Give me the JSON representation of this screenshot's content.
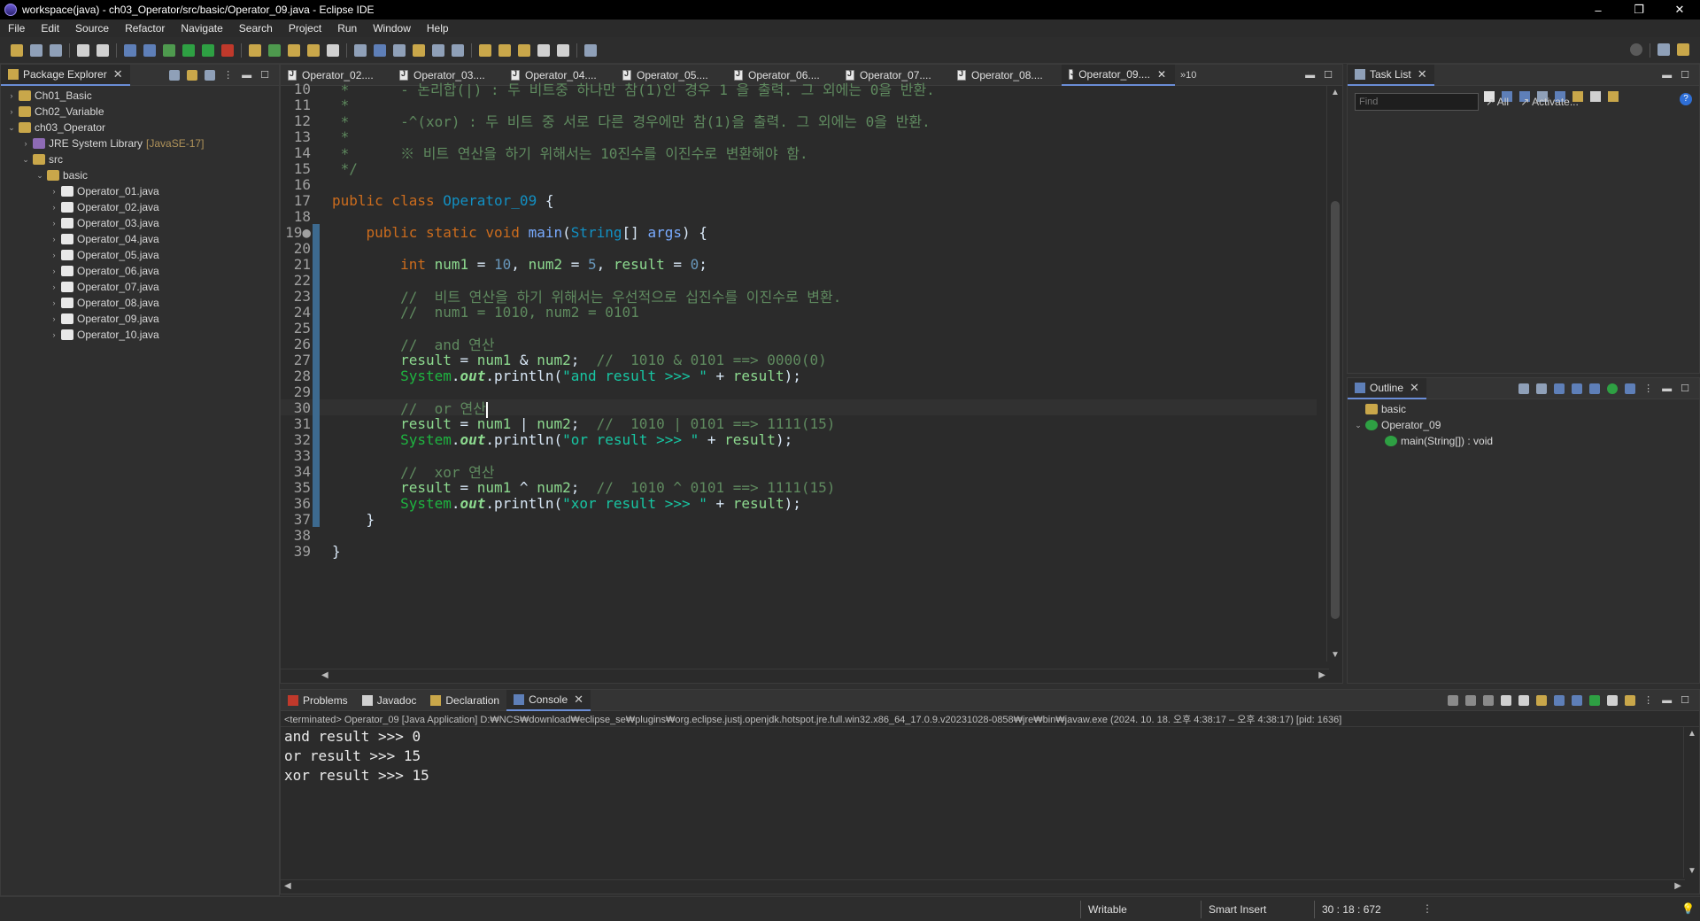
{
  "window": {
    "title": "workspace(java) - ch03_Operator/src/basic/Operator_09.java - Eclipse IDE",
    "minimize": "–",
    "restore": "❐",
    "close": "✕"
  },
  "menu": [
    "File",
    "Edit",
    "Source",
    "Refactor",
    "Navigate",
    "Search",
    "Project",
    "Run",
    "Window",
    "Help"
  ],
  "package_explorer": {
    "tab_label": "Package Explorer",
    "items": [
      {
        "label": "Ch01_Basic",
        "indent": 0,
        "twisty": "›",
        "icon": "project-icon"
      },
      {
        "label": "Ch02_Variable",
        "indent": 0,
        "twisty": "›",
        "icon": "project-icon"
      },
      {
        "label": "ch03_Operator",
        "indent": 0,
        "twisty": "⌄",
        "icon": "project-icon"
      },
      {
        "label": "JRE System Library",
        "tag": "[JavaSE-17]",
        "indent": 1,
        "twisty": "›",
        "icon": "library-icon"
      },
      {
        "label": "src",
        "indent": 1,
        "twisty": "⌄",
        "icon": "source-folder-icon"
      },
      {
        "label": "basic",
        "indent": 2,
        "twisty": "⌄",
        "icon": "package-icon"
      },
      {
        "label": "Operator_01.java",
        "indent": 3,
        "twisty": "›",
        "icon": "java-file-icon"
      },
      {
        "label": "Operator_02.java",
        "indent": 3,
        "twisty": "›",
        "icon": "java-file-icon"
      },
      {
        "label": "Operator_03.java",
        "indent": 3,
        "twisty": "›",
        "icon": "java-file-icon"
      },
      {
        "label": "Operator_04.java",
        "indent": 3,
        "twisty": "›",
        "icon": "java-file-icon"
      },
      {
        "label": "Operator_05.java",
        "indent": 3,
        "twisty": "›",
        "icon": "java-file-icon"
      },
      {
        "label": "Operator_06.java",
        "indent": 3,
        "twisty": "›",
        "icon": "java-file-icon"
      },
      {
        "label": "Operator_07.java",
        "indent": 3,
        "twisty": "›",
        "icon": "java-file-icon"
      },
      {
        "label": "Operator_08.java",
        "indent": 3,
        "twisty": "›",
        "icon": "java-file-icon"
      },
      {
        "label": "Operator_09.java",
        "indent": 3,
        "twisty": "›",
        "icon": "java-file-icon"
      },
      {
        "label": "Operator_10.java",
        "indent": 3,
        "twisty": "›",
        "icon": "java-file-icon"
      }
    ]
  },
  "editor": {
    "tabs": [
      "Operator_02....",
      "Operator_03....",
      "Operator_04....",
      "Operator_05....",
      "Operator_06....",
      "Operator_07....",
      "Operator_08....",
      "Operator_09...."
    ],
    "active_tab": 7,
    "overflow": "»10",
    "lines": [
      {
        "n": "10",
        "tokens": [
          [
            "cm",
            " *      - 논리합(|) : 두 비트중 하나만 참(1)인 경우 1 을 출력. 그 외에는 0을 반환."
          ]
        ]
      },
      {
        "n": "11",
        "tokens": [
          [
            "cm",
            " *"
          ]
        ]
      },
      {
        "n": "12",
        "tokens": [
          [
            "cm",
            " *      -^(xor) : 두 비트 중 서로 다른 경우에만 참(1)을 출력. 그 외에는 0을 반환."
          ]
        ]
      },
      {
        "n": "13",
        "tokens": [
          [
            "cm",
            " *"
          ]
        ]
      },
      {
        "n": "14",
        "tokens": [
          [
            "cm",
            " *      ※ 비트 연산을 하기 위해서는 10진수를 이진수로 변환해야 함."
          ]
        ]
      },
      {
        "n": "15",
        "tokens": [
          [
            "cm",
            " */"
          ]
        ]
      },
      {
        "n": "16",
        "tokens": []
      },
      {
        "n": "17",
        "tokens": [
          [
            "kw",
            "public class "
          ],
          [
            "cls",
            "Operator_09"
          ],
          [
            "plain",
            " {"
          ]
        ]
      },
      {
        "n": "18",
        "tokens": []
      },
      {
        "n": "19●",
        "tokens": [
          [
            "plain",
            "    "
          ],
          [
            "kw",
            "public static void "
          ],
          [
            "par",
            "main"
          ],
          [
            "plain",
            "("
          ],
          [
            "cls",
            "String"
          ],
          [
            "plain",
            "[] "
          ],
          [
            "par",
            "args"
          ],
          [
            "plain",
            ") {"
          ]
        ]
      },
      {
        "n": "20",
        "tokens": []
      },
      {
        "n": "21",
        "tokens": [
          [
            "plain",
            "        "
          ],
          [
            "kw",
            "int "
          ],
          [
            "fld",
            "num1"
          ],
          [
            "plain",
            " = "
          ],
          [
            "num",
            "10"
          ],
          [
            "plain",
            ", "
          ],
          [
            "fld",
            "num2"
          ],
          [
            "plain",
            " = "
          ],
          [
            "num",
            "5"
          ],
          [
            "plain",
            ", "
          ],
          [
            "fld",
            "result"
          ],
          [
            "plain",
            " = "
          ],
          [
            "num",
            "0"
          ],
          [
            "plain",
            ";"
          ]
        ]
      },
      {
        "n": "22",
        "tokens": []
      },
      {
        "n": "23",
        "tokens": [
          [
            "plain",
            "        "
          ],
          [
            "cm",
            "//  비트 연산을 하기 위해서는 우선적으로 십진수를 이진수로 변환."
          ]
        ]
      },
      {
        "n": "24",
        "tokens": [
          [
            "plain",
            "        "
          ],
          [
            "cm",
            "//  num1 = 1010, num2 = 0101"
          ]
        ]
      },
      {
        "n": "25",
        "tokens": []
      },
      {
        "n": "26",
        "tokens": [
          [
            "plain",
            "        "
          ],
          [
            "cm",
            "//  and 연산"
          ]
        ]
      },
      {
        "n": "27",
        "tokens": [
          [
            "plain",
            "        "
          ],
          [
            "fld",
            "result"
          ],
          [
            "plain",
            " = "
          ],
          [
            "fld",
            "num1"
          ],
          [
            "plain",
            " & "
          ],
          [
            "fld",
            "num2"
          ],
          [
            "plain",
            ";  "
          ],
          [
            "cm",
            "//  1010 & 0101 ==> 0000(0)"
          ]
        ]
      },
      {
        "n": "28",
        "tokens": [
          [
            "plain",
            "        "
          ],
          [
            "sysout",
            "System"
          ],
          [
            "plain",
            "."
          ],
          [
            "outf",
            "out"
          ],
          [
            "plain",
            ".println("
          ],
          [
            "str",
            "\"and result >>> \""
          ],
          [
            "plain",
            " + "
          ],
          [
            "fld",
            "result"
          ],
          [
            "plain",
            ");"
          ]
        ]
      },
      {
        "n": "29",
        "tokens": []
      },
      {
        "n": "30",
        "tokens": [
          [
            "plain",
            "        "
          ],
          [
            "cm",
            "//  or 연산"
          ]
        ],
        "current": true
      },
      {
        "n": "31",
        "tokens": [
          [
            "plain",
            "        "
          ],
          [
            "fld",
            "result"
          ],
          [
            "plain",
            " = "
          ],
          [
            "fld",
            "num1"
          ],
          [
            "plain",
            " | "
          ],
          [
            "fld",
            "num2"
          ],
          [
            "plain",
            ";  "
          ],
          [
            "cm",
            "//  1010 | 0101 ==> 1111(15)"
          ]
        ]
      },
      {
        "n": "32",
        "tokens": [
          [
            "plain",
            "        "
          ],
          [
            "sysout",
            "System"
          ],
          [
            "plain",
            "."
          ],
          [
            "outf",
            "out"
          ],
          [
            "plain",
            ".println("
          ],
          [
            "str",
            "\"or result >>> \""
          ],
          [
            "plain",
            " + "
          ],
          [
            "fld",
            "result"
          ],
          [
            "plain",
            ");"
          ]
        ]
      },
      {
        "n": "33",
        "tokens": []
      },
      {
        "n": "34",
        "tokens": [
          [
            "plain",
            "        "
          ],
          [
            "cm",
            "//  xor 연산"
          ]
        ]
      },
      {
        "n": "35",
        "tokens": [
          [
            "plain",
            "        "
          ],
          [
            "fld",
            "result"
          ],
          [
            "plain",
            " = "
          ],
          [
            "fld",
            "num1"
          ],
          [
            "plain",
            " ^ "
          ],
          [
            "fld",
            "num2"
          ],
          [
            "plain",
            ";  "
          ],
          [
            "cm",
            "//  1010 ^ 0101 ==> 1111(15)"
          ]
        ]
      },
      {
        "n": "36",
        "tokens": [
          [
            "plain",
            "        "
          ],
          [
            "sysout",
            "System"
          ],
          [
            "plain",
            "."
          ],
          [
            "outf",
            "out"
          ],
          [
            "plain",
            ".println("
          ],
          [
            "str",
            "\"xor result >>> \""
          ],
          [
            "plain",
            " + "
          ],
          [
            "fld",
            "result"
          ],
          [
            "plain",
            ");"
          ]
        ]
      },
      {
        "n": "37",
        "tokens": [
          [
            "plain",
            "    }"
          ]
        ]
      },
      {
        "n": "38",
        "tokens": []
      },
      {
        "n": "39",
        "tokens": [
          [
            "plain",
            "}"
          ]
        ]
      }
    ]
  },
  "task_list": {
    "tab_label": "Task List",
    "find_placeholder": "Find",
    "all_link": "All",
    "activate_link": "Activate..."
  },
  "outline": {
    "tab_label": "Outline",
    "items": [
      {
        "label": "basic",
        "indent": 0,
        "icon": "package-icon"
      },
      {
        "label": "Operator_09",
        "indent": 0,
        "twisty": "⌄",
        "icon": "class-icon"
      },
      {
        "label": "main(String[]) : void",
        "indent": 1,
        "icon": "method-icon"
      }
    ]
  },
  "console_panel": {
    "tabs": [
      "Problems",
      "Javadoc",
      "Declaration",
      "Console"
    ],
    "active_tab": 3,
    "info": "<terminated> Operator_09 [Java Application] D:₩NCS₩download₩eclipse_se₩plugins₩org.eclipse.justj.openjdk.hotspot.jre.full.win32.x86_64_17.0.9.v20231028-0858₩jre₩bin₩javaw.exe  (2024. 10. 18. 오후 4:38:17 – 오후 4:38:17) [pid: 1636]",
    "output": [
      "and result >>> 0",
      "or result >>> 15",
      "xor result >>> 15"
    ]
  },
  "status_bar": {
    "writable": "Writable",
    "insert_mode": "Smart Insert",
    "position": "30 : 18 : 672"
  },
  "colors": {
    "background": "#2f2f2f",
    "editor_bg": "#2b2b2b",
    "keyword": "#cc6c1d",
    "comment": "#5f8a5f",
    "string": "#17c6a3",
    "field": "#8dda8f"
  }
}
